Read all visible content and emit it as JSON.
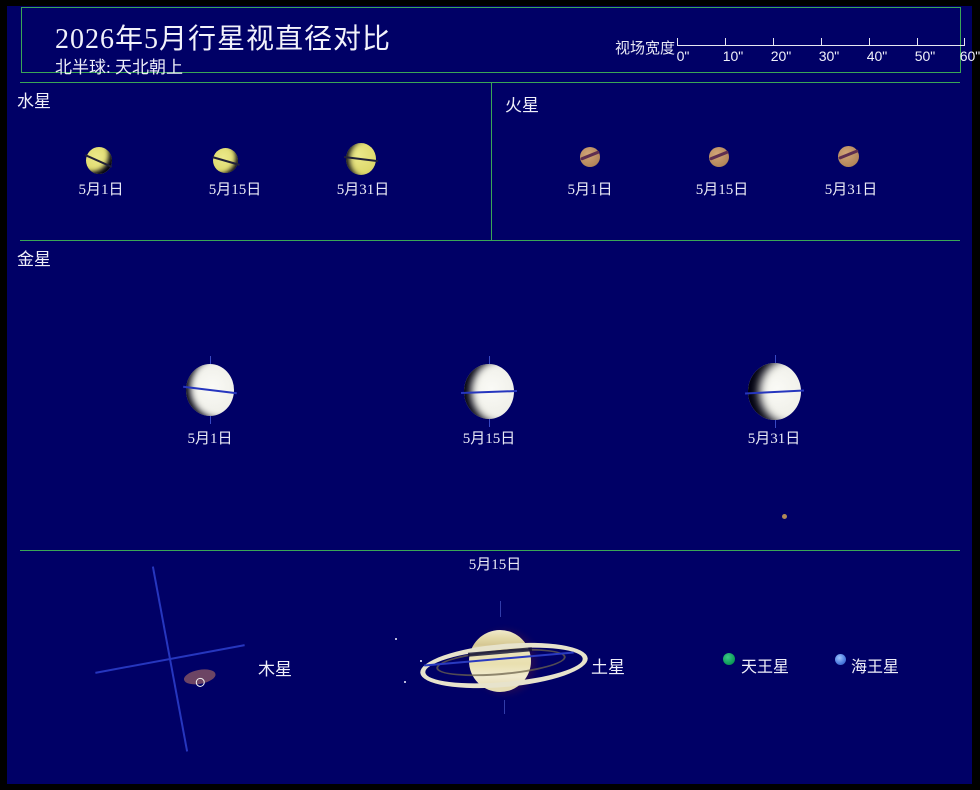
{
  "header": {
    "title": "2026年5月行星视直径对比",
    "subtitle": "北半球: 天北朝上",
    "fov_scale": {
      "label": "视场宽度",
      "tick_labels": [
        "0\"",
        "10\"",
        "20\"",
        "30\"",
        "40\"",
        "50\"",
        "60\""
      ],
      "range_arcsec": [
        0,
        60
      ]
    }
  },
  "sections": {
    "mercury": {
      "label": "水星",
      "dates": [
        "5月1日",
        "5月15日",
        "5月31日"
      ]
    },
    "mars": {
      "label": "火星",
      "dates": [
        "5月1日",
        "5月15日",
        "5月31日"
      ]
    },
    "venus": {
      "label": "金星",
      "dates": [
        "5月1日",
        "5月15日",
        "5月31日"
      ]
    },
    "outer": {
      "date": "5月15日",
      "jupiter": {
        "label": "木星"
      },
      "saturn": {
        "label": "土星"
      },
      "uranus": {
        "label": "天王星"
      },
      "neptune": {
        "label": "海王星"
      }
    }
  },
  "colors": {
    "background": "#000066",
    "frame": "#000000",
    "grid_green": "#3AA657",
    "text": "#ECECF8",
    "axis_blue": "#2636BE",
    "mercury": "#DFDA6E",
    "mars": "#B2865B",
    "venus": "#EFEFE8",
    "jupiter": "#D4C7A8",
    "saturn": "#E9E0B0",
    "uranus": "#0E9C59",
    "neptune": "#4B7ADE"
  }
}
